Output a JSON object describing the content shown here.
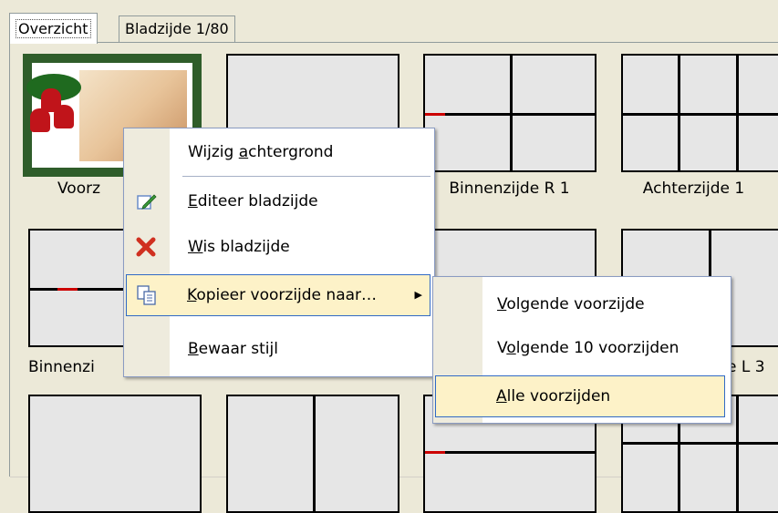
{
  "tabs": [
    {
      "label": "Overzicht",
      "active": true
    },
    {
      "label": "Bladzijde 1/80",
      "active": false
    }
  ],
  "cells": {
    "voorzijde": "Voorz",
    "binnenzijde_r1": "Binnenzijde R 1",
    "achterzijde": "Achterzijde 1",
    "binnenzijde_l": "Binnenzi",
    "e_l3": "e L 3"
  },
  "context_menu": {
    "items": [
      {
        "label": "Wijzig achtergrond",
        "mnemonic": "a",
        "icon": "none"
      },
      {
        "label": "Editeer bladzijde",
        "mnemonic": "E",
        "icon": "pencil-icon"
      },
      {
        "label": "Wis bladzijde",
        "mnemonic": "W",
        "icon": "delete-x-icon"
      },
      {
        "label": "Kopieer voorzijde naar…",
        "mnemonic": "K",
        "icon": "copy-icon",
        "submenu": true
      },
      {
        "label": "Bewaar stijl",
        "mnemonic": "B",
        "icon": "none"
      }
    ]
  },
  "submenu": {
    "items": [
      {
        "label": "Volgende voorzijde",
        "mnemonic": "V"
      },
      {
        "label": "Volgende 10 voorzijden",
        "mnemonic": "o"
      },
      {
        "label": "Alle voorzijden",
        "mnemonic": "A"
      }
    ]
  },
  "colors": {
    "highlight_fill": "#fdf2c8",
    "highlight_border": "#316ac5",
    "delete_red": "#d03020"
  }
}
